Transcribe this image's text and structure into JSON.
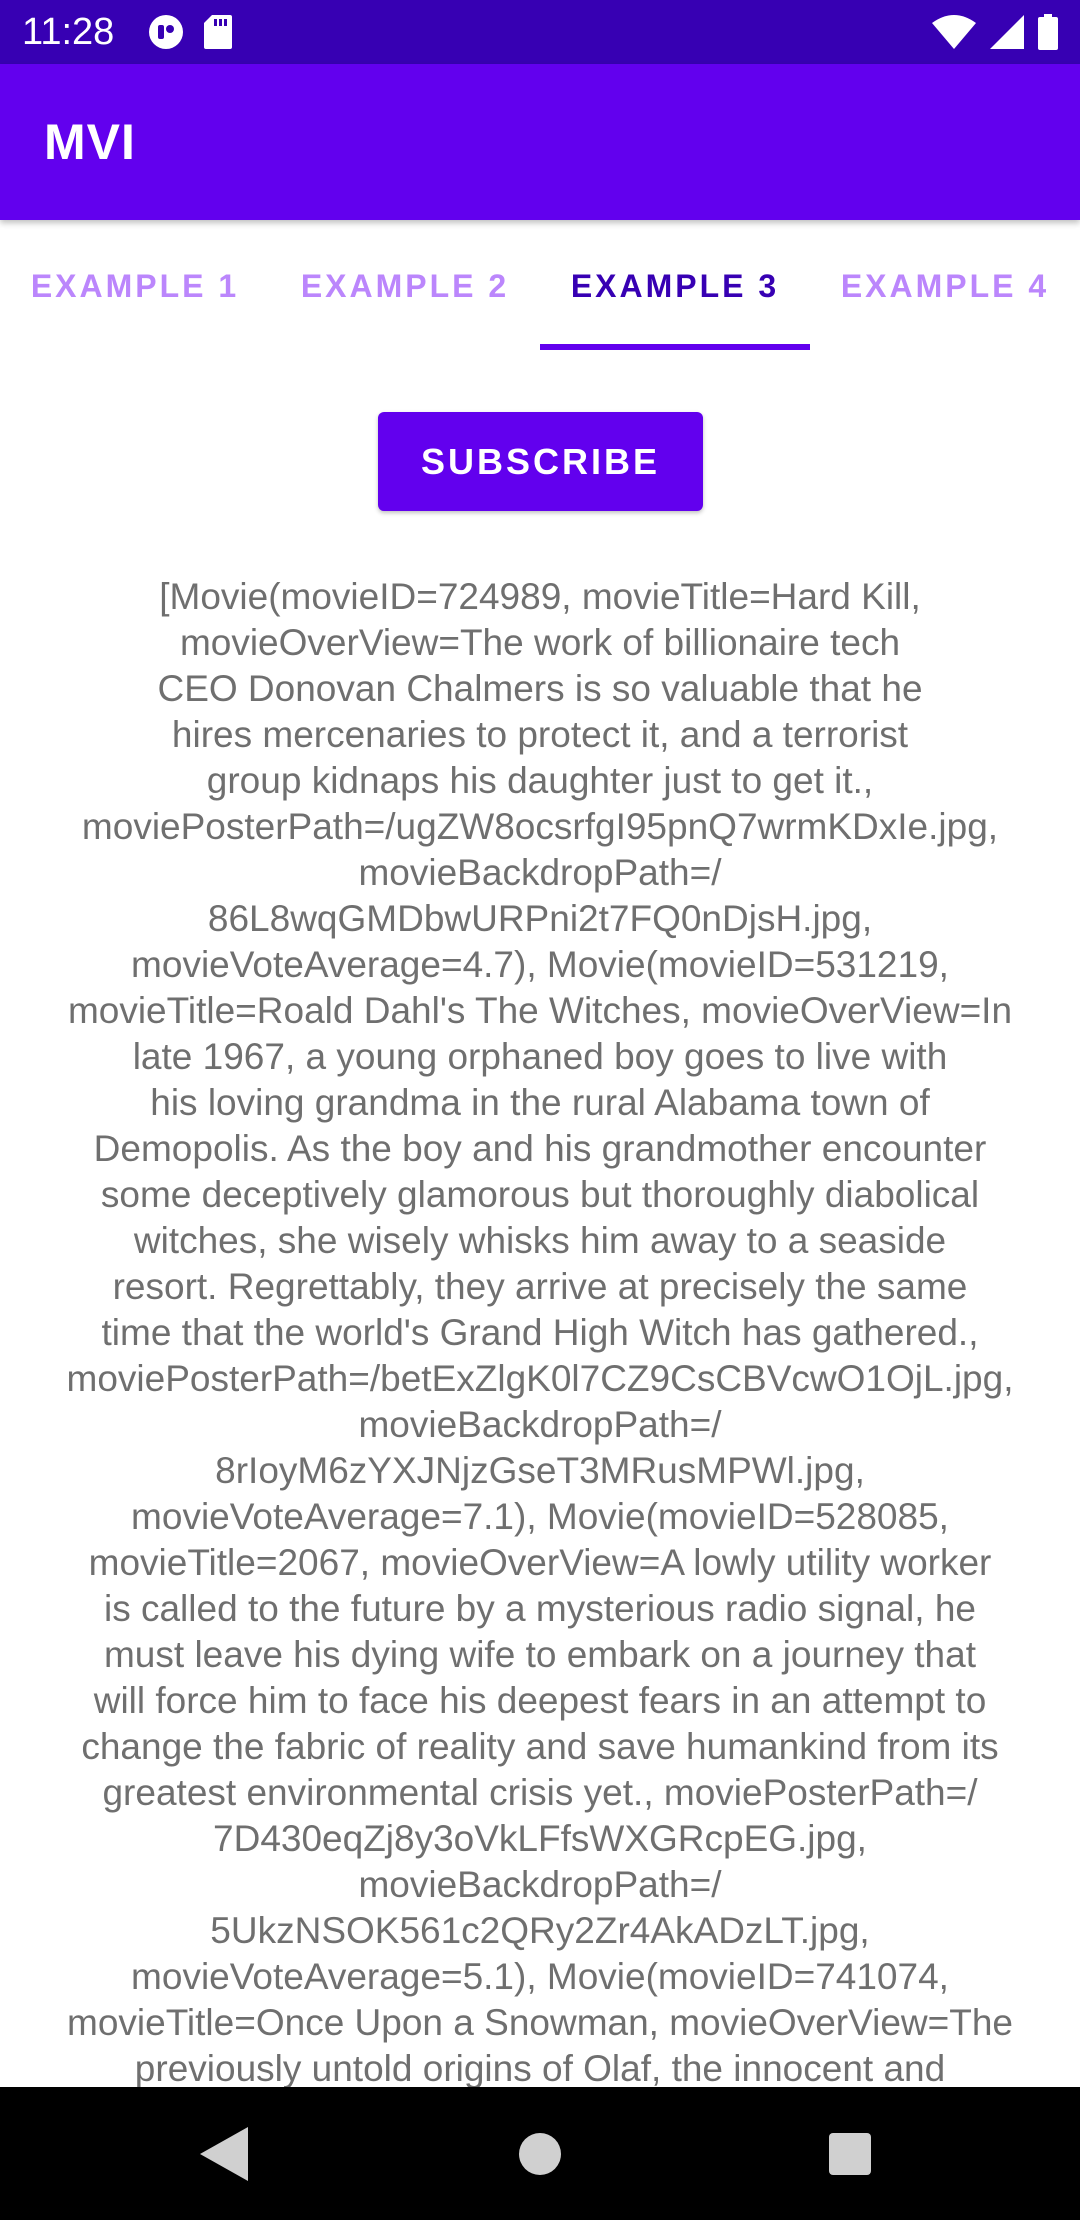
{
  "status_bar": {
    "time": "11:28",
    "icons_left": [
      "app-notification-icon",
      "sd-card-icon"
    ],
    "icons_right": [
      "wifi-icon",
      "cellular-signal-icon",
      "battery-icon"
    ]
  },
  "app_bar": {
    "title": "MVI"
  },
  "tabs": [
    {
      "label": "EXAMPLE 1",
      "selected": false
    },
    {
      "label": "EXAMPLE 2",
      "selected": false
    },
    {
      "label": "EXAMPLE 3",
      "selected": true
    },
    {
      "label": "EXAMPLE 4",
      "selected": false
    }
  ],
  "subscribe_button": {
    "label": "SUBSCRIBE"
  },
  "result_text": "[Movie(movieID=724989, movieTitle=Hard Kill,\nmovieOverView=The work of billionaire tech\nCEO Donovan Chalmers is so valuable that he\nhires mercenaries to protect it, and a terrorist\ngroup kidnaps his daughter just to get it.,\nmoviePosterPath=/ugZW8ocsrfgI95pnQ7wrmKDxIe.jpg,\nmovieBackdropPath=/\n86L8wqGMDbwURPni2t7FQ0nDjsH.jpg,\nmovieVoteAverage=4.7), Movie(movieID=531219,\nmovieTitle=Roald Dahl's The Witches, movieOverView=In\nlate 1967, a young orphaned boy goes to live with\nhis loving grandma in the rural Alabama town of\nDemopolis. As the boy and his grandmother encounter\nsome deceptively glamorous but thoroughly diabolical\nwitches, she wisely whisks him away to a seaside\nresort. Regrettably, they arrive at precisely the same\ntime that the world's Grand High Witch has gathered.,\nmoviePosterPath=/betExZlgK0l7CZ9CsCBVcwO1OjL.jpg,\nmovieBackdropPath=/\n8rIoyM6zYXJNjzGseT3MRusMPWl.jpg,\nmovieVoteAverage=7.1), Movie(movieID=528085,\nmovieTitle=2067, movieOverView=A lowly utility worker\nis called to the future by a mysterious radio signal, he\nmust leave his dying wife to embark on a journey that\nwill force him to face his deepest fears in an attempt to\nchange the fabric of reality and save humankind from its\ngreatest environmental crisis yet., moviePosterPath=/\n7D430eqZj8y3oVkLFfsWXGRcpEG.jpg,\nmovieBackdropPath=/\n5UkzNSOK561c2QRy2Zr4AkADzLT.jpg,\nmovieVoteAverage=5.1), Movie(movieID=741074,\nmovieTitle=Once Upon a Snowman, movieOverView=The\npreviously untold origins of Olaf, the innocent and",
  "nav_bar": {
    "buttons": [
      "back-icon",
      "home-icon",
      "recent-apps-icon"
    ]
  },
  "colors": {
    "status_bar": "#3700B3",
    "app_bar": "#6200EE",
    "tab_active": "#3700B3",
    "tab_inactive": "#BB86FC",
    "indicator": "#6200EE",
    "button": "#6200EE"
  }
}
